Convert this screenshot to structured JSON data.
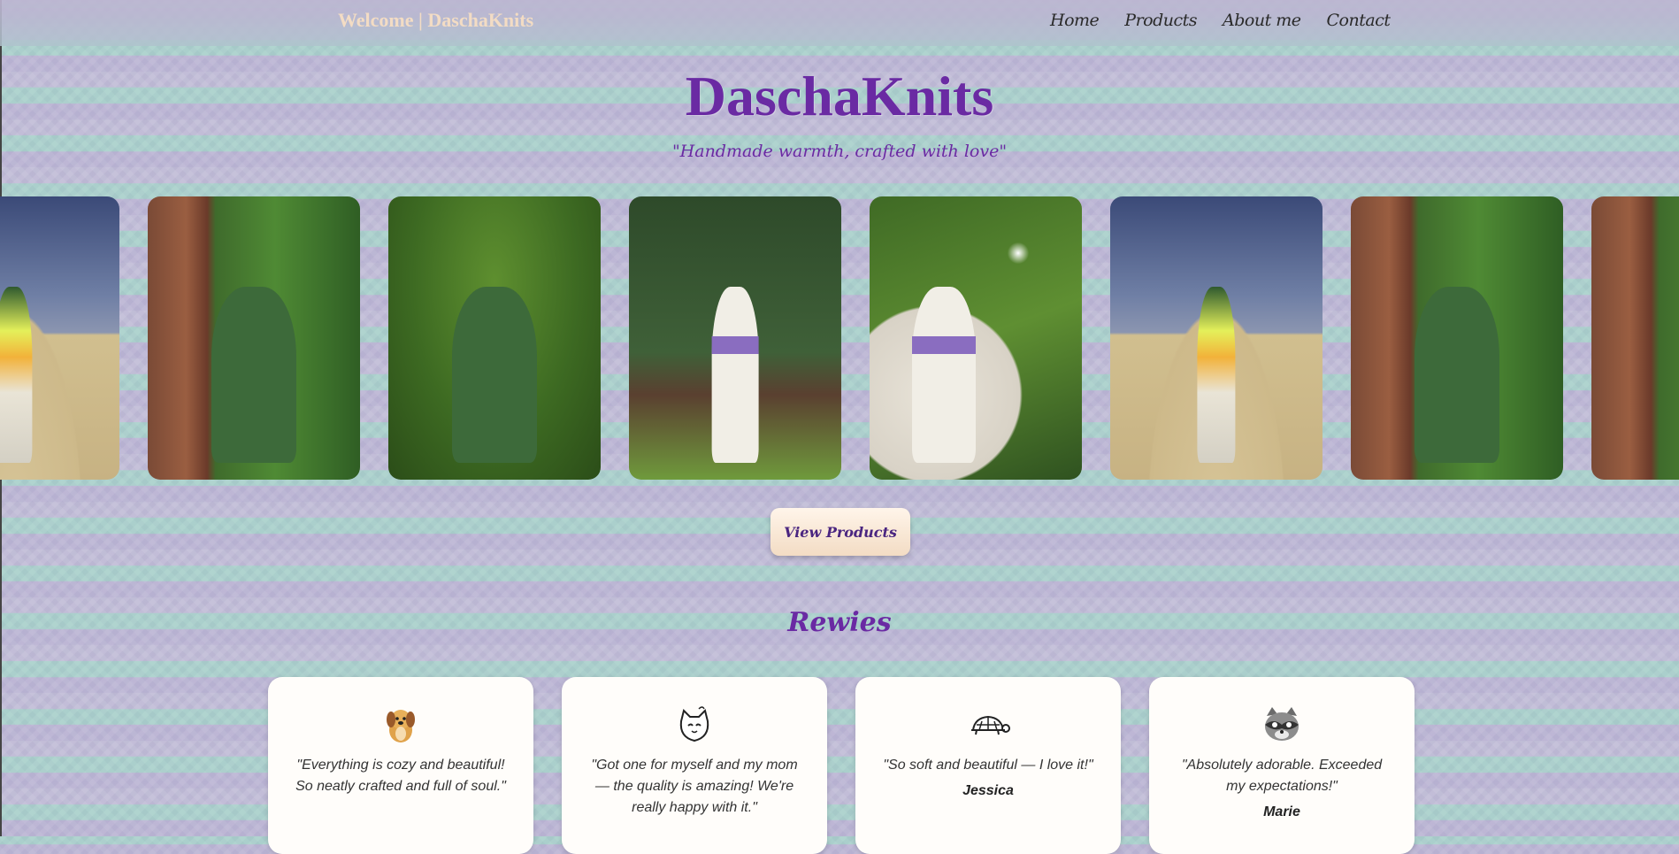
{
  "header": {
    "welcome": "Welcome | DaschaKnits",
    "nav": [
      "Home",
      "Products",
      "About me",
      "Contact"
    ]
  },
  "hero": {
    "brand": "DaschaKnits",
    "tagline": "\"Handmade warmth, crafted with love\""
  },
  "gallery": {
    "photos": [
      {
        "scene": "sand-dune",
        "icon": "photo-icon"
      },
      {
        "scene": "church-green-cardigan",
        "icon": "photo-icon"
      },
      {
        "scene": "forest-green-cardigan",
        "icon": "photo-icon"
      },
      {
        "scene": "tree-white-dress",
        "icon": "photo-icon"
      },
      {
        "scene": "daisy-mirror",
        "icon": "photo-icon"
      },
      {
        "scene": "sand-dune",
        "icon": "photo-icon"
      },
      {
        "scene": "church-green-cardigan",
        "icon": "photo-icon"
      },
      {
        "scene": "green-partial",
        "icon": "photo-icon"
      }
    ]
  },
  "cta": {
    "view_products": "View Products"
  },
  "reviews": {
    "title": "Rewies",
    "items": [
      {
        "icon": "dog-icon",
        "text": "\"Everything is cozy and beautiful! So neatly crafted and full of soul.\"",
        "author": ""
      },
      {
        "icon": "cat-icon",
        "text": "\"Got one for myself and my mom — the quality is amazing! We're really happy with it.\"",
        "author": ""
      },
      {
        "icon": "turtle-icon",
        "text": "\"So soft and beautiful — I love it!\"",
        "author": "Jessica"
      },
      {
        "icon": "raccoon-icon",
        "text": "\"Absolutely adorable. Exceeded my expectations!\"",
        "author": "Marie"
      }
    ]
  },
  "colors": {
    "brand_purple": "#6a2aa3",
    "welcome_cream": "#f3dcc4",
    "button_bg": "#f3dcc4"
  }
}
